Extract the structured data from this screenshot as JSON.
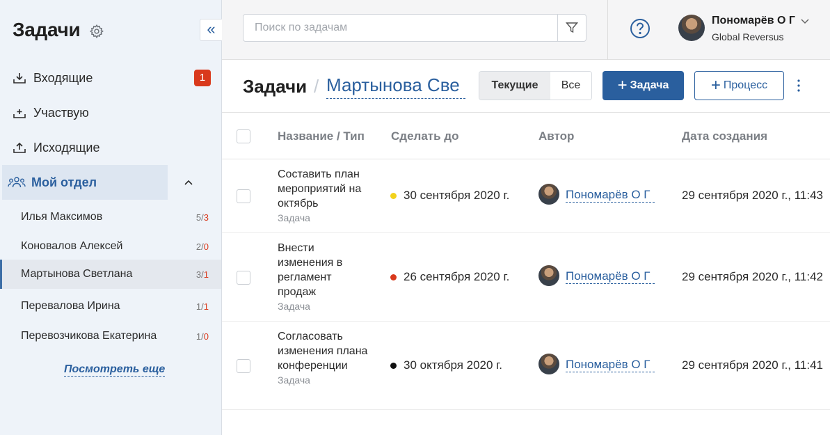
{
  "sidebar": {
    "title": "Задачи",
    "nav": [
      {
        "label": "Входящие",
        "icon": "inbox-icon"
      },
      {
        "label": "Участвую",
        "icon": "participate-icon"
      },
      {
        "label": "Исходящие",
        "icon": "outbox-icon"
      }
    ],
    "inbox_badge": "1",
    "department": {
      "label": "Мой отдел",
      "icon": "team-icon"
    },
    "members": [
      {
        "name": "Илья Максимов",
        "count": "5/",
        "overdue": "3",
        "active": false
      },
      {
        "name": "Коновалов Алексей",
        "count": "2/",
        "overdue": "0",
        "active": false
      },
      {
        "name": "Мартынова Светлана",
        "count": "3/",
        "overdue": "1",
        "active": true
      },
      {
        "name": "Перевалова Ирина",
        "count": "1/",
        "overdue": "1",
        "active": false
      },
      {
        "name": "Перевозчикова Екатерина",
        "count": "1/",
        "overdue": "0",
        "active": false
      }
    ],
    "see_more": "Посмотреть еще"
  },
  "topbar": {
    "search_placeholder": "Поиск по задачам",
    "user_name": "Пономарёв О Г",
    "user_org": "Global Reversus"
  },
  "header": {
    "crumb_root": "Задачи",
    "crumb_separator": "/",
    "crumb_current": "Мартынова Све",
    "seg_current": "Текущие",
    "seg_all": "Все",
    "btn_task": "Задача",
    "btn_process": "Процесс"
  },
  "table": {
    "columns": [
      "Название / Тип",
      "Сделать до",
      "Автор",
      "Дата создания"
    ],
    "rows": [
      {
        "name": "Составить план мероприятий на октябрь",
        "type": "Задача",
        "due": "30 сентября 2020 г.",
        "dot_color": "#f2d21b",
        "author": "Пономарёв О Г",
        "created": "29 сентября 2020 г., 11:43"
      },
      {
        "name": "Внести изменения в регламент продаж",
        "type": "Задача",
        "due": "26 сентября 2020 г.",
        "dot_color": "#d9391c",
        "author": "Пономарёв О Г",
        "created": "29 сентября 2020 г., 11:42"
      },
      {
        "name": "Согласовать изменения плана конференции",
        "type": "Задача",
        "due": "30 октября 2020 г.",
        "dot_color": "#111111",
        "author": "Пономарёв О Г",
        "created": "29 сентября 2020 г., 11:41"
      }
    ]
  },
  "colors": {
    "accent": "#2a5f9e",
    "badge": "#d9391c",
    "sidebar_bg": "#eef3f9"
  }
}
